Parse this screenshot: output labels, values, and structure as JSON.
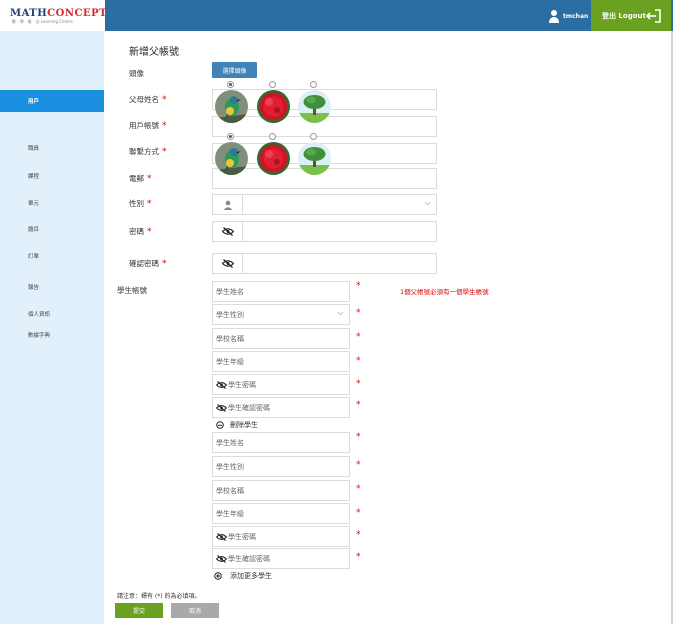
{
  "header": {
    "logo_main_1": "MATH",
    "logo_main_2": "CONCEPT",
    "logo_sub": "數 · 學 · 概 · 念 Learning Centre",
    "username": "tmchan",
    "logout_label": "登出 Logout",
    "colors": {
      "bar": "#2b6ea3",
      "logout": "#6aa121"
    }
  },
  "sidebar": {
    "items": [
      {
        "label": "用戶",
        "active": true
      },
      {
        "label": "職員"
      },
      {
        "label": "課程"
      },
      {
        "label": "單元"
      },
      {
        "label": "題目"
      },
      {
        "label": "訂單"
      },
      {
        "label": "報告"
      },
      {
        "label": "個人資訊"
      },
      {
        "label": "數據字典"
      }
    ]
  },
  "form": {
    "title": "新增父帳號",
    "avatar_label": "頭像",
    "choose_avatar": "選擇頭像",
    "parent_name_label": "父母姓名",
    "username_label": "用戶帳號",
    "contact_label": "聯繫方式",
    "email_label": "電郵",
    "gender_label": "性別",
    "password_label": "密碼",
    "confirm_password_label": "確認密碼",
    "student_account_label": "學生帳號",
    "required_mark": "*",
    "student_warning": "1個父帳號必須有一個學生帳號",
    "avatar_options": [
      "bird",
      "red-flower",
      "tree",
      "bird",
      "red-flower",
      "tree"
    ]
  },
  "students": [
    {
      "name_ph": "學生姓名",
      "gender_ph": "學生性別",
      "school_ph": "學校名稱",
      "grade_ph": "學生年級",
      "password_ph": "學生密碼",
      "confirm_ph": "學生確認密碼"
    },
    {
      "name_ph": "學生姓名",
      "gender_ph": "學生性別",
      "school_ph": "學校名稱",
      "grade_ph": "學生年級",
      "password_ph": "學生密碼",
      "confirm_ph": "學生確認密碼"
    }
  ],
  "actions": {
    "remove_student": "刪除學生",
    "add_more_students": "添加更多學生",
    "note": "請注意：標有 (*) 的為必填項。",
    "submit": "提交",
    "cancel": "取消"
  }
}
